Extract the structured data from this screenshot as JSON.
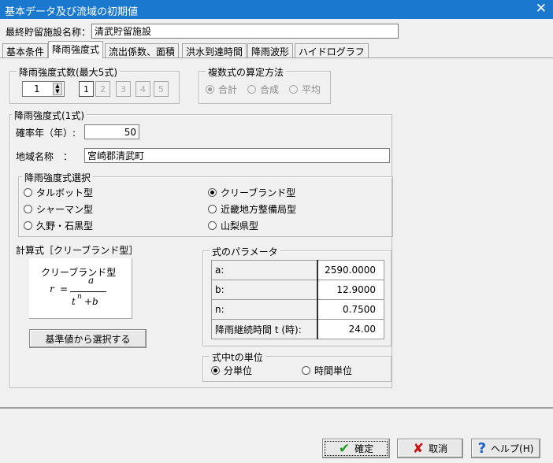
{
  "window": {
    "title": "基本データ及び流域の初期値",
    "close": "✕"
  },
  "facility": {
    "label": "最終貯留施設名称：",
    "value": "清武貯留施設"
  },
  "tabs": [
    "基本条件",
    "降雨強度式",
    "流出係数、面積",
    "洪水到達時間",
    "降雨波形",
    "ハイドログラフ"
  ],
  "count_group": {
    "label": "降雨強度式数(最大5式)",
    "value": "1",
    "buttons": [
      "1",
      "2",
      "3",
      "4",
      "5"
    ]
  },
  "method_group": {
    "label": "複数式の算定方法",
    "options": [
      "合計",
      "合成",
      "平均"
    ],
    "selected": 0
  },
  "formula_group": {
    "label": "降雨強度式(1式)",
    "year_label": "確率年（年）:",
    "year_value": "50",
    "region_label": "地域名称　：",
    "region_value": "宮崎郡清武町"
  },
  "type_group": {
    "label": "降雨強度式選択",
    "options": [
      "タルボット型",
      "シャーマン型",
      "久野・石黒型",
      "クリーブランド型",
      "近畿地方整備局型",
      "山梨県型"
    ],
    "selected": 3
  },
  "calc": {
    "label": "計算式［クリーブランド型］",
    "box_title": "クリーブランド型",
    "r": "r",
    "eq": "=",
    "a": "a",
    "t": "t",
    "n": "n",
    "plus_b": "+b",
    "select_button": "基準値から選択する"
  },
  "params": {
    "label": "式のパラメータ",
    "rows": [
      {
        "label": "a:",
        "value": "2590.0000"
      },
      {
        "label": "b:",
        "value": "12.9000"
      },
      {
        "label": "n:",
        "value": "0.7500"
      },
      {
        "label": "降雨継続時間 t (時):",
        "value": "24.00"
      }
    ]
  },
  "unit_group": {
    "label": "式中tの単位",
    "options": [
      "分単位",
      "時間単位"
    ],
    "selected": 0
  },
  "footer": {
    "ok": "確定",
    "cancel": "取消",
    "help": "ヘルプ(H)"
  },
  "colors": {
    "titlebar": "#1a78cf",
    "ok": "#1c9b1c",
    "cancel": "#cc1111",
    "help": "#1a5fc8"
  }
}
